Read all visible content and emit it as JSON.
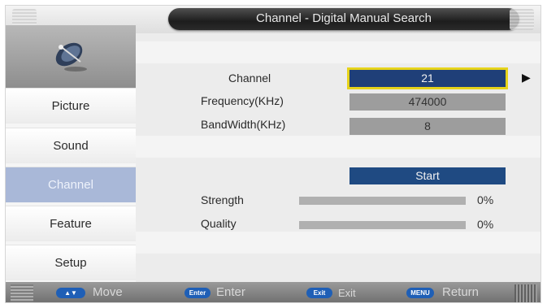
{
  "header": {
    "title": "Channel - Digital Manual Search"
  },
  "sidebar": {
    "icon": "satellite-dish-icon",
    "items": [
      {
        "label": "Picture"
      },
      {
        "label": "Sound"
      },
      {
        "label": "Channel",
        "active": true
      },
      {
        "label": "Feature"
      },
      {
        "label": "Setup"
      }
    ]
  },
  "main": {
    "channel": {
      "label": "Channel",
      "value": "21"
    },
    "frequency": {
      "label": "Frequency(KHz)",
      "value": "474000"
    },
    "bandwidth": {
      "label": "BandWidth(KHz)",
      "value": "8"
    },
    "start": {
      "label": "Start"
    },
    "strength": {
      "label": "Strength",
      "value": "0%",
      "level": 0
    },
    "quality": {
      "label": "Quality",
      "value": "0%",
      "level": 0
    }
  },
  "footer": {
    "move": {
      "key": "▲▼",
      "label": "Move"
    },
    "enter": {
      "key": "Enter",
      "label": "Enter"
    },
    "exit": {
      "key": "Exit",
      "label": "Exit"
    },
    "return": {
      "key": "MENU",
      "label": "Return"
    }
  },
  "colors": {
    "selected_field": "#1f3f78",
    "selection_outline": "#e6d31a",
    "active_sidebar": "#a9b8d8",
    "key_button": "#1f5fb6"
  }
}
